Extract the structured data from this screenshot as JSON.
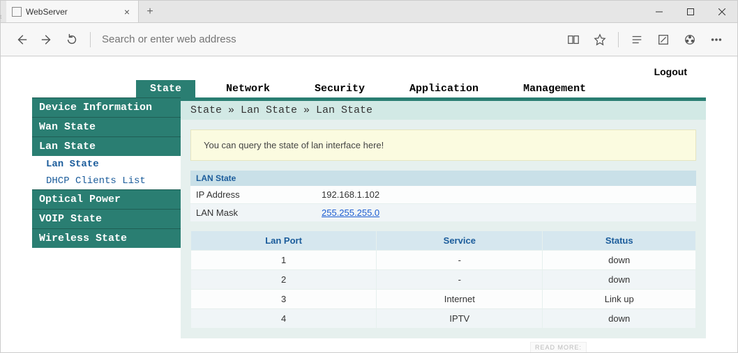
{
  "browser": {
    "tab_title": "WebServer",
    "address_placeholder": "Search or enter web address"
  },
  "header": {
    "logout": "Logout"
  },
  "main_tabs": [
    "State",
    "Network",
    "Security",
    "Application",
    "Management"
  ],
  "sidebar": {
    "items": [
      {
        "label": "Device Information",
        "type": "head"
      },
      {
        "label": "Wan State",
        "type": "head"
      },
      {
        "label": "Lan State",
        "type": "head"
      },
      {
        "label": "Lan State",
        "type": "sub",
        "active": true
      },
      {
        "label": "DHCP Clients List",
        "type": "sub"
      },
      {
        "label": "Optical Power",
        "type": "head"
      },
      {
        "label": "VOIP State",
        "type": "head"
      },
      {
        "label": "Wireless State",
        "type": "head"
      }
    ]
  },
  "breadcrumb": "State » Lan State » Lan State",
  "infobox": "You can query the state of lan interface here!",
  "lan_state": {
    "title": "LAN State",
    "rows": [
      {
        "key": "IP Address",
        "value": "192.168.1.102",
        "link": false
      },
      {
        "key": "LAN Mask",
        "value": "255.255.255.0",
        "link": true
      }
    ]
  },
  "ports": {
    "headers": [
      "Lan Port",
      "Service",
      "Status"
    ],
    "rows": [
      {
        "port": "1",
        "service": "-",
        "status": "down"
      },
      {
        "port": "2",
        "service": "-",
        "status": "down"
      },
      {
        "port": "3",
        "service": "Internet",
        "status": "Link up"
      },
      {
        "port": "4",
        "service": "IPTV",
        "status": "down"
      }
    ]
  },
  "artifact": "READ MORE:"
}
